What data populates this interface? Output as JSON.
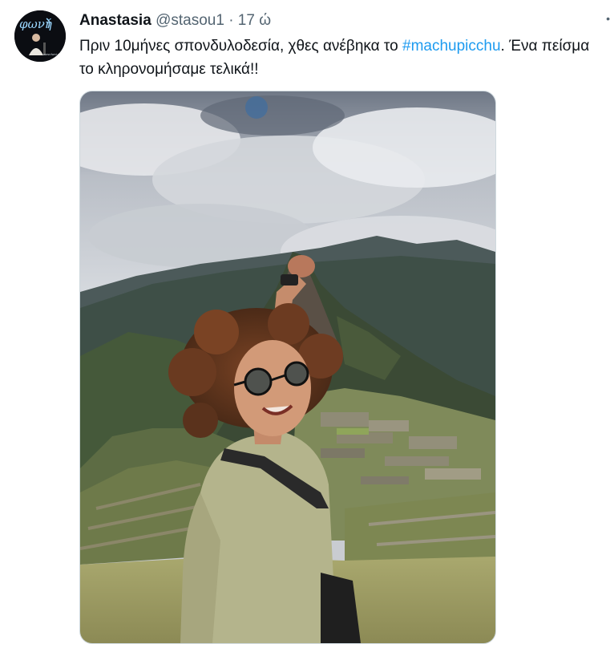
{
  "tweet": {
    "display_name": "Anastasia",
    "handle": "@stasou1",
    "separator": "·",
    "time": "17 ώ",
    "more_icon": "more-dots-icon",
    "text_before": "Πριν 10μήνες σπονδυλοδεσία, χθες ανέβηκα το ",
    "hashtag": "#machupicchu",
    "text_after": ". Ένα πείσμα το κληρονομήσαμε τελικά!!"
  },
  "avatar": {
    "logo_text": "φωνή",
    "url_text": "www.fwni.gr"
  },
  "colors": {
    "text": "#0f1419",
    "secondary": "#536471",
    "link": "#1d9bf0"
  }
}
